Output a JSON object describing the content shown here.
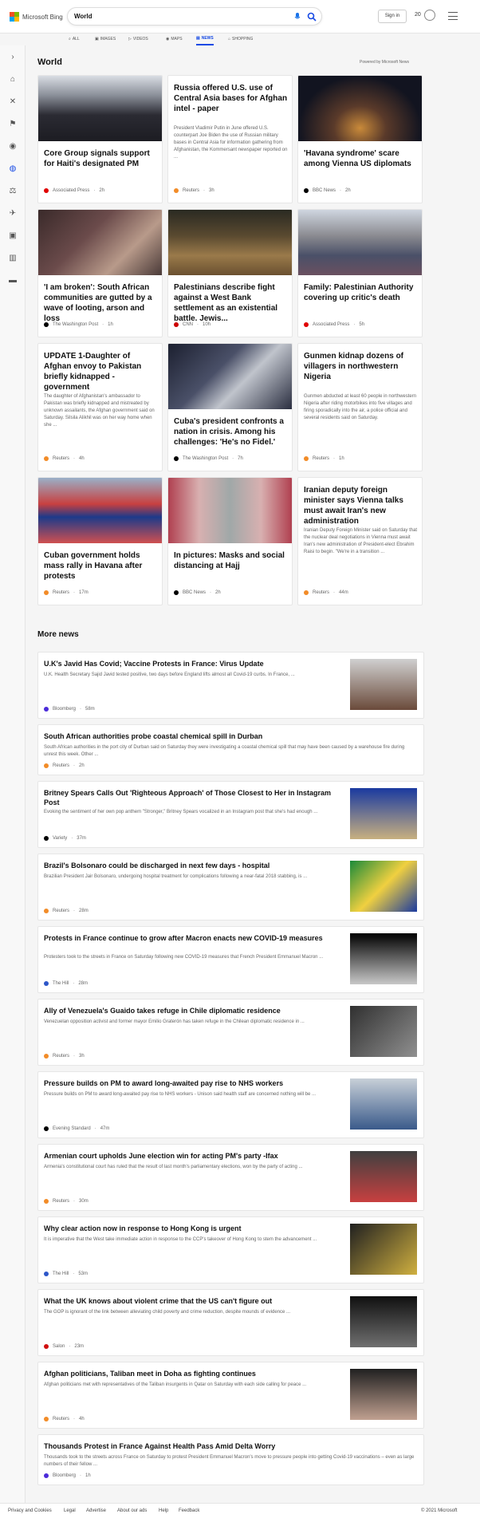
{
  "header": {
    "logo_text": "Microsoft Bing",
    "search_value": "World",
    "signin_label": "Sign in",
    "points": "20"
  },
  "tabs": [
    {
      "label": "ALL",
      "active": false
    },
    {
      "label": "IMAGES",
      "active": false
    },
    {
      "label": "VIDEOS",
      "active": false
    },
    {
      "label": "MAPS",
      "active": false
    },
    {
      "label": "NEWS",
      "active": true
    },
    {
      "label": "SHOPPING",
      "active": false
    }
  ],
  "section": {
    "title": "World",
    "powered_by": "Powered by Microsoft News"
  },
  "cards": [
    {
      "title": "Core Group signals support for Haiti's designated PM",
      "source": "Associated Press",
      "time": "2h",
      "src_color": "#e00000"
    },
    {
      "title": "Russia offered U.S. use of Central Asia bases for Afghan intel - paper",
      "desc": "President Vladimir Putin in June offered U.S. counterpart Joe Biden the use of Russian military bases in Central Asia for information gathering from Afghanistan, the Kommersant newspaper reported on ...",
      "source": "Reuters",
      "time": "3h",
      "src_color": "#f28c28"
    },
    {
      "title": "'Havana syndrome' scare among Vienna US diplomats",
      "source": "BBC News",
      "time": "2h",
      "src_color": "#000000"
    },
    {
      "title": "'I am broken': South African communities are gutted by a wave of looting, arson and loss",
      "source": "The Washington Post",
      "time": "1h",
      "src_color": "#000000"
    },
    {
      "title": "Palestinians describe fight against a West Bank settlement as an existential battle. Jewis...",
      "source": "CNN",
      "time": "10h",
      "src_color": "#cc0000"
    },
    {
      "title": "Family: Palestinian Authority covering up critic's death",
      "source": "Associated Press",
      "time": "5h",
      "src_color": "#e00000"
    },
    {
      "title": "UPDATE 1-Daughter of Afghan envoy to Pakistan briefly kidnapped - government",
      "desc": "The daughter of Afghanistan's ambassador to Pakistan was briefly kidnapped and mistreated by unknown assailants, the Afghan government said on Saturday. Silsila Alikhil was on her way home when she ...",
      "source": "Reuters",
      "time": "4h",
      "src_color": "#f28c28"
    },
    {
      "title": "Cuba's president confronts a nation in crisis. Among his challenges: 'He's no Fidel.'",
      "source": "The Washington Post",
      "time": "7h",
      "src_color": "#000000"
    },
    {
      "title": "Gunmen kidnap dozens of villagers in northwestern Nigeria",
      "desc": "Gunmen abducted at least 60 people in northwestern Nigeria after riding motorbikes into five villages and firing sporadically into the air, a police official and several residents said on Saturday.",
      "source": "Reuters",
      "time": "1h",
      "src_color": "#f28c28"
    },
    {
      "title": "Cuban government holds mass rally in Havana after protests",
      "source": "Reuters",
      "time": "17m",
      "src_color": "#f28c28"
    },
    {
      "title": "In pictures: Masks and social distancing at Hajj",
      "source": "BBC News",
      "time": "2h",
      "src_color": "#000000"
    },
    {
      "title": "Iranian deputy foreign minister says Vienna talks must await Iran's new administration",
      "desc": "Iranian Deputy Foreign Minister said on Saturday that the nuclear deal negotiations in Vienna must await Iran's new administration of President-elect Ebrahim Raisi to begin. \"We're in a transition ...",
      "source": "Reuters",
      "time": "44m",
      "src_color": "#f28c28"
    }
  ],
  "more": {
    "title": "More news",
    "items": [
      {
        "title": "U.K's Javid Has Covid; Vaccine Protests in France: Virus Update",
        "snippet": "U.K. Health Secretary Sajid Javid tested positive, two days before England lifts almost all Covid-19 curbs. In France, ...",
        "source": "Bloomberg",
        "time": "58m",
        "src_color": "#4b2bd9"
      },
      {
        "title": "South African authorities probe coastal chemical spill in Durban",
        "snippet": "South African authorities in the port city of Durban said on Saturday they were investigating a coastal chemical spill that may have been caused by a warehouse fire during unrest this week. Other ...",
        "source": "Reuters",
        "time": "2h",
        "src_color": "#f28c28"
      },
      {
        "title": "Britney Spears Calls Out 'Righteous Approach' of Those Closest to Her in Instagram Post",
        "snippet": "Evoking the sentiment of her own pop anthem \"Stronger,\" Britney Spears vocalized in an Instagram post that she's had enough ...",
        "source": "Variety",
        "time": "37m",
        "src_color": "#000000"
      },
      {
        "title": "Brazil's Bolsonaro could be discharged in next few days - hospital",
        "snippet": "Brazilian President Jair Bolsonaro, undergoing hospital treatment for complications following a near-fatal 2018 stabbing, is ...",
        "source": "Reuters",
        "time": "28m",
        "src_color": "#f28c28"
      },
      {
        "title": "Protests in France continue to grow after Macron enacts new COVID-19 measures",
        "snippet": "Protesters took to the streets in France on Saturday following new COVID-19 measures that French President Emmanuel Macron ...",
        "source": "The Hill",
        "time": "28m",
        "src_color": "#2d56c8"
      },
      {
        "title": "Ally of Venezuela's Guaido takes refuge in Chile diplomatic residence",
        "snippet": "Venezuelan opposition activist and former mayor Emilio Graterón has taken refuge in the Chilean diplomatic residence in ...",
        "source": "Reuters",
        "time": "3h",
        "src_color": "#f28c28"
      },
      {
        "title": "Pressure builds on PM to award long-awaited pay rise to NHS workers",
        "snippet": "Pressure builds on PM to award long-awaited pay rise to NHS workers - Unison said health staff are concerned nothing will be ...",
        "source": "Evening Standard",
        "time": "47m",
        "src_color": "#000000"
      },
      {
        "title": "Armenian court upholds June election win for acting PM's party -Ifax",
        "snippet": "Armenia's constitutional court has ruled that the result of last month's parliamentary elections, won by the party of acting ...",
        "source": "Reuters",
        "time": "30m",
        "src_color": "#f28c28"
      },
      {
        "title": "Why clear action now in response to Hong Kong is urgent",
        "snippet": "It is imperative that the West take immediate action in response to the CCP's takeover of Hong Kong to stem the advancement ...",
        "source": "The Hill",
        "time": "53m",
        "src_color": "#2d56c8"
      },
      {
        "title": "What the UK knows about violent crime that the US can't figure out",
        "snippet": "The GOP is ignorant of the link between alleviating child poverty and crime reduction, despite mounds of evidence ...",
        "source": "Salon",
        "time": "23m",
        "src_color": "#d01010"
      },
      {
        "title": "Afghan politicians, Taliban meet in Doha as fighting continues",
        "snippet": "Afghan politicians met with representatives of the Taliban insurgents in Qatar on Saturday with each side calling for peace ...",
        "source": "Reuters",
        "time": "4h",
        "src_color": "#f28c28"
      },
      {
        "title": "Thousands Protest in France Against Health Pass Amid Delta Worry",
        "snippet": "Thousands took to the streets across France on Saturday to protest President Emmanuel Macron's move to pressure people into getting Covid-19 vaccinations – even as large numbers of their fellow ...",
        "source": "Bloomberg",
        "time": "1h",
        "src_color": "#4b2bd9"
      }
    ]
  },
  "footer": {
    "links": [
      "Privacy and Cookies",
      "Legal",
      "Advertise",
      "About our ads",
      "Help",
      "Feedback"
    ],
    "copyright": "© 2021 Microsoft"
  }
}
